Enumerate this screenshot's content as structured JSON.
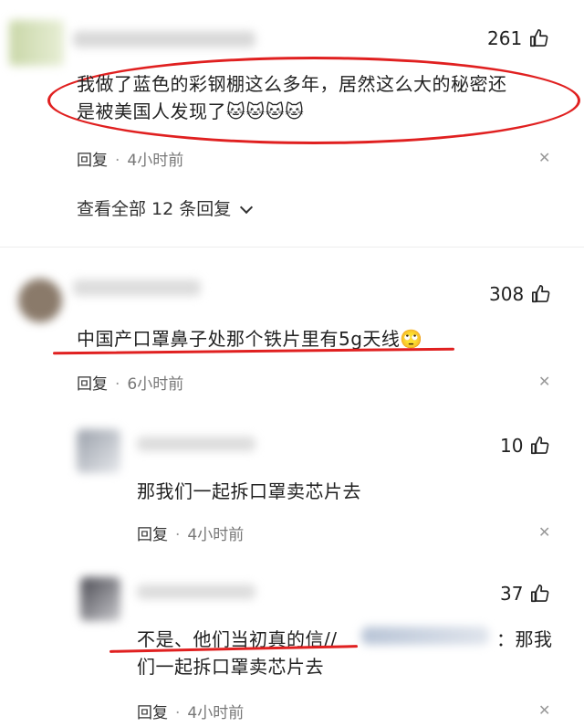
{
  "comments": [
    {
      "likes": "261",
      "text_line1": "我做了蓝色的彩钢棚这么多年，居然这么大的秘密还",
      "text_line2": "是被美国人发现了",
      "emoji_text": "🐱🐱🐱🐱",
      "reply_label": "回复",
      "time": "4小时前",
      "view_replies": "查看全部 12 条回复"
    },
    {
      "likes": "308",
      "text": "中国产口罩鼻子处那个铁片里有5g天线",
      "emoji": "🙄",
      "reply_label": "回复",
      "time": "6小时前"
    }
  ],
  "replies": [
    {
      "likes": "10",
      "text": "那我们一起拆口罩卖芯片去",
      "reply_label": "回复",
      "time": "4小时前"
    },
    {
      "likes": "37",
      "text_prefix": "不是、他们当初真的信//",
      "text_suffix": "：那我",
      "text_line2": "们一起拆口罩卖芯片去",
      "reply_label": "回复",
      "time": "4小时前"
    }
  ],
  "dot": "·",
  "close": "✕",
  "chevron": "⌄",
  "colors": {
    "annotation": "#e02020"
  }
}
